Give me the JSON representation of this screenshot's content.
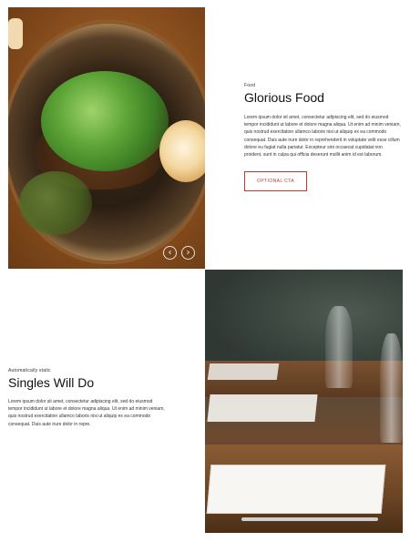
{
  "section1": {
    "eyebrow": "Food",
    "title": "Glorious Food",
    "body": "Lorem ipsum dolor sit amet, consectetur adipiscing elit, sed do eiusmod tempor incididunt ut labore et dolore magna aliqua. Ut enim ad minim veniam, quis nostrud exercitation ullamco laboris nisi ut aliquip ex ea commodo consequat. Duis aute irure dolor in reprehenderit in voluptate velit esse cillum dolore eu fugiat nulla pariatur. Excepteur sint occaecat cupidatat non proident, sunt in culpa qui officia deserunt mollit anim id est laborum.",
    "cta_label": "OPTIONAL CTA",
    "carousel": {
      "prev_glyph": "‹",
      "next_glyph": "›"
    }
  },
  "section2": {
    "eyebrow": "Automatically static",
    "title": "Singles Will Do",
    "body": "Lorem ipsum dolor sit amet, consectetur adipiscing elit, sed do eiusmod tempor incididunt ut labore et dolore magna aliqua. Ut enim ad minim veniam, quis nostrud exercitation ullamco laboris nisi ut aliquip ex ea commodo consequat. Duis aute irure dolor in repre."
  },
  "colors": {
    "accent": "#c0392b",
    "text": "#222222",
    "background": "#ffffff"
  },
  "icons": {
    "prev": "chevron-left-icon",
    "next": "chevron-right-icon"
  }
}
